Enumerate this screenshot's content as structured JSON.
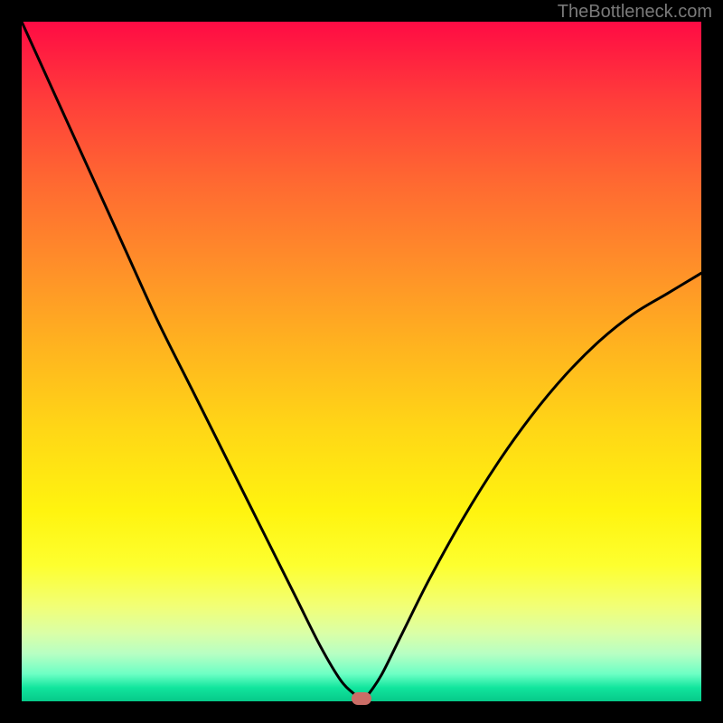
{
  "watermark": "TheBottleneck.com",
  "chart_data": {
    "type": "line",
    "title": "",
    "xlabel": "",
    "ylabel": "",
    "xlim": [
      0,
      100
    ],
    "ylim": [
      0,
      100
    ],
    "series": [
      {
        "name": "bottleneck-curve",
        "x": [
          0,
          5,
          10,
          15,
          20,
          25,
          30,
          35,
          40,
          44,
          47,
          49,
          50,
          51,
          53,
          56,
          60,
          65,
          70,
          75,
          80,
          85,
          90,
          95,
          100
        ],
        "values": [
          100,
          89,
          78,
          67,
          56,
          46,
          36,
          26,
          16,
          8,
          3,
          1,
          0,
          1,
          4,
          10,
          18,
          27,
          35,
          42,
          48,
          53,
          57,
          60,
          63
        ]
      }
    ],
    "marker": {
      "x": 50,
      "y": 0
    },
    "gradient_stops": [
      {
        "pct": 0,
        "color": "#ff0b44"
      },
      {
        "pct": 50,
        "color": "#ffd716"
      },
      {
        "pct": 85,
        "color": "#fdff2f"
      },
      {
        "pct": 100,
        "color": "#06c989"
      }
    ]
  }
}
